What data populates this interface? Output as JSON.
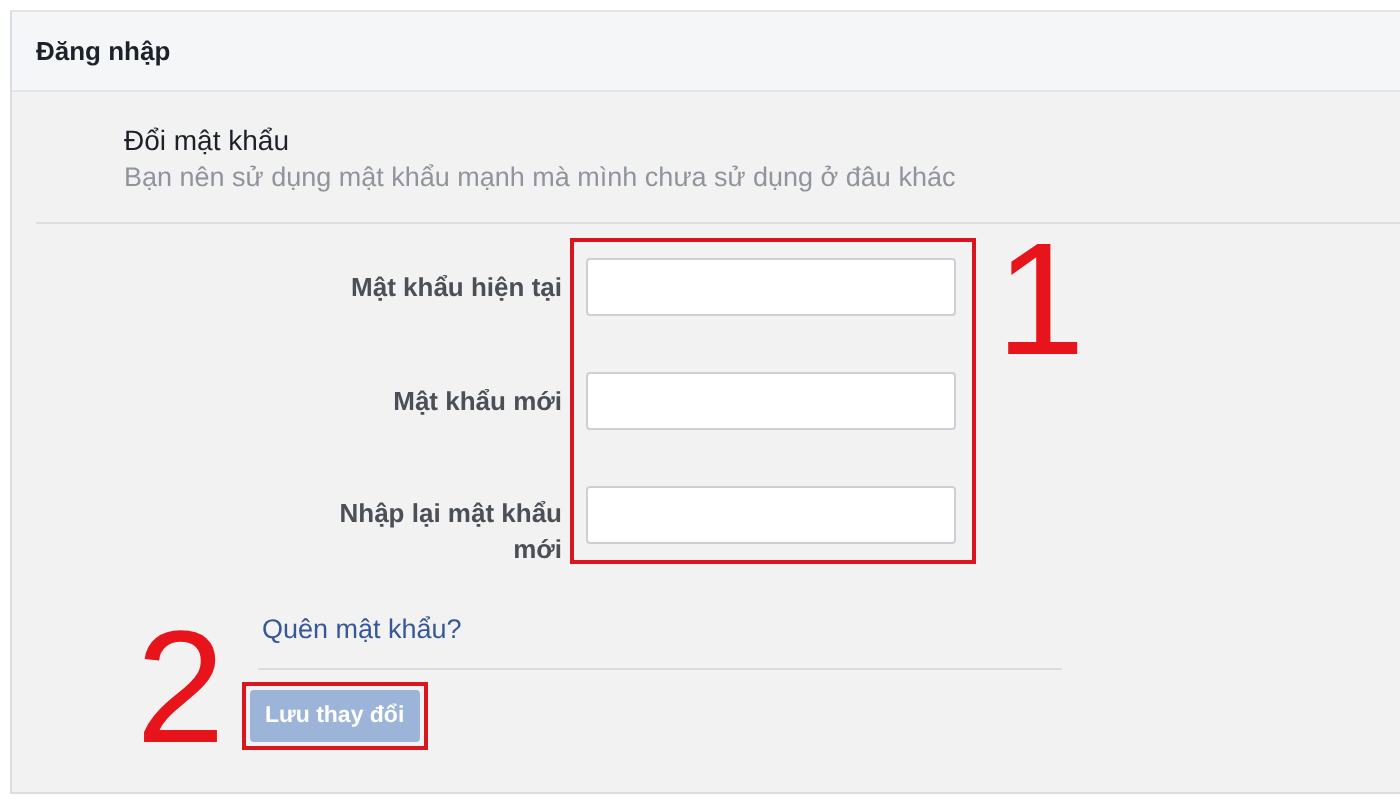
{
  "header": {
    "title": "Đăng nhập"
  },
  "section": {
    "title": "Đổi mật khẩu",
    "description": "Bạn nên sử dụng mật khẩu mạnh mà mình chưa sử dụng ở đâu khác"
  },
  "password_form": {
    "step": "1",
    "fields": [
      {
        "label": "Mật khẩu hiện tại"
      },
      {
        "label": "Mật khẩu mới"
      },
      {
        "label": "Nhập lại mật khẩu mới"
      }
    ]
  },
  "forgot_link": "Quên mật khẩu?",
  "save_button": {
    "label": "Lưu thay đổi",
    "disabled": true,
    "step": "2"
  }
}
